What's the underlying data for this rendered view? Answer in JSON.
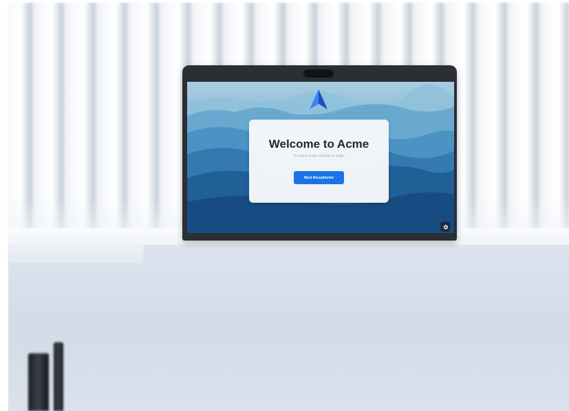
{
  "welcome": {
    "title": "Welcome to Acme",
    "subtitle": "To check in tap Continue to begin",
    "button_label": "Meet Receptionist"
  },
  "icons": {
    "logo": "acme-arrow-logo-icon",
    "settings": "gear-icon"
  },
  "colors": {
    "accent": "#1a73e8",
    "logo": "#2563eb",
    "settings_bg": "#1b2a44"
  }
}
